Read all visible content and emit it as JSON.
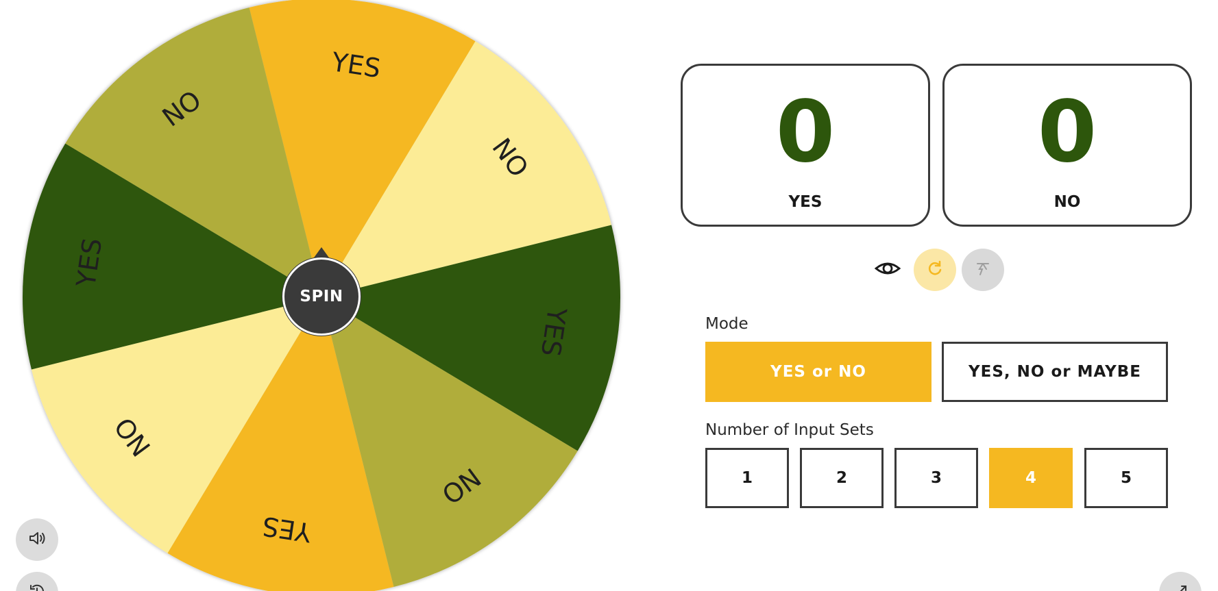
{
  "wheel": {
    "spin_label": "SPIN",
    "segments": [
      {
        "label": "YES",
        "color": "#f5b821"
      },
      {
        "label": "NO",
        "color": "#fcec96"
      },
      {
        "label": "YES",
        "color": "#2d560c"
      },
      {
        "label": "NO",
        "color": "#b0ad3b"
      },
      {
        "label": "YES",
        "color": "#f5b821"
      },
      {
        "label": "NO",
        "color": "#fcec96"
      },
      {
        "label": "YES",
        "color": "#2d560c"
      },
      {
        "label": "NO",
        "color": "#b0ad3b"
      }
    ]
  },
  "scores": [
    {
      "value": "0",
      "label": "YES"
    },
    {
      "value": "0",
      "label": "NO"
    }
  ],
  "toolbar": {
    "icons": [
      "eye-icon",
      "reset-icon",
      "clear-icon"
    ]
  },
  "mode": {
    "label": "Mode",
    "options": [
      "YES or NO",
      "YES, NO or MAYBE"
    ],
    "selected": "YES or NO"
  },
  "input_sets": {
    "label": "Number of Input Sets",
    "options": [
      "1",
      "2",
      "3",
      "4",
      "5"
    ],
    "selected": "4"
  },
  "corner_buttons": [
    "sound-icon",
    "history-icon",
    "fullscreen-icon"
  ],
  "colors": {
    "accent": "#f5b821",
    "dark_green": "#2d560c",
    "olive": "#b0ad3b",
    "light_yellow": "#fcec96"
  }
}
